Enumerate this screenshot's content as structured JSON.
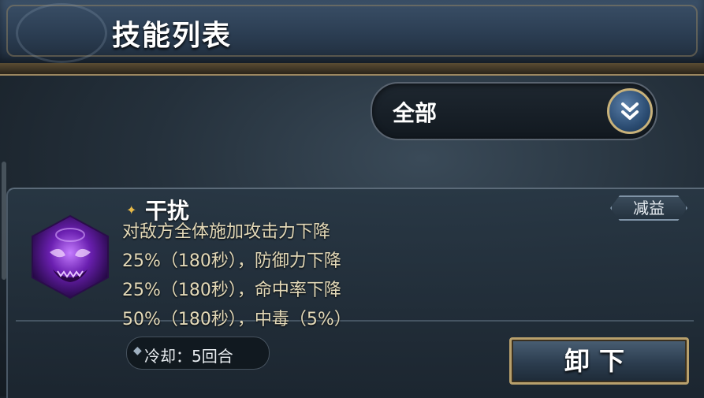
{
  "header": {
    "title": "技能列表"
  },
  "filter": {
    "selected": "全部",
    "icon": "double-chevron-down-icon"
  },
  "skill": {
    "name": "干扰",
    "tag": "减益",
    "description": [
      "对敌方全体施加攻击力下降",
      "25%（180秒），防御力下降",
      "25%（180秒），命中率下降",
      "50%（180秒），中毒（5%）"
    ],
    "cooldown": "冷却：5回合",
    "icon": "purple-shadow-skill-icon"
  },
  "actions": {
    "unload_label": "卸下"
  },
  "colors": {
    "accent_gold": "#c9b27a",
    "desc_text": "#e3d9b8",
    "star": "#e7b948"
  }
}
